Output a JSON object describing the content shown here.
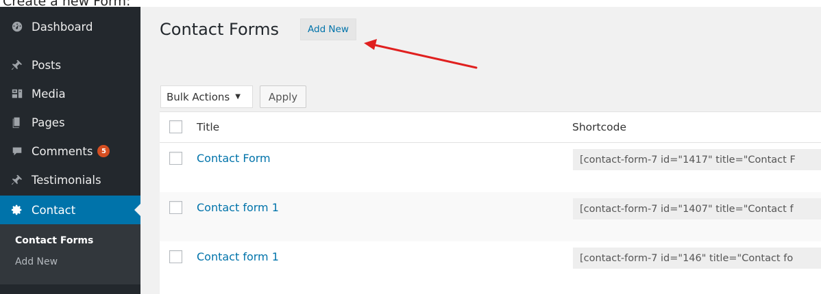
{
  "caption": "Create a new Form:",
  "sidebar": {
    "items": [
      {
        "label": "Dashboard",
        "icon": "dashboard-icon"
      },
      {
        "label": "Posts",
        "icon": "pushpin-icon"
      },
      {
        "label": "Media",
        "icon": "media-icon"
      },
      {
        "label": "Pages",
        "icon": "pages-icon"
      },
      {
        "label": "Comments",
        "icon": "comment-icon",
        "badge": "5"
      },
      {
        "label": "Testimonials",
        "icon": "pushpin-icon"
      },
      {
        "label": "Contact",
        "icon": "gear-icon",
        "active": true
      }
    ],
    "submenu": [
      {
        "label": "Contact Forms",
        "current": true
      },
      {
        "label": "Add New"
      }
    ]
  },
  "main": {
    "page_title": "Contact Forms",
    "add_new_label": "Add New",
    "bulk_actions": "Bulk Actions",
    "apply_label": "Apply",
    "columns": {
      "title": "Title",
      "shortcode": "Shortcode"
    },
    "rows": [
      {
        "title": "Contact Form",
        "shortcode": "[contact-form-7 id=\"1417\" title=\"Contact F"
      },
      {
        "title": "Contact form 1",
        "shortcode": "[contact-form-7 id=\"1407\" title=\"Contact f"
      },
      {
        "title": "Contact form 1",
        "shortcode": "[contact-form-7 id=\"146\" title=\"Contact fo"
      }
    ]
  },
  "colors": {
    "sidebar_bg": "#23282d",
    "active_bg": "#0073aa",
    "link": "#0073aa",
    "badge": "#d54e21",
    "arrow": "#e0201f"
  }
}
